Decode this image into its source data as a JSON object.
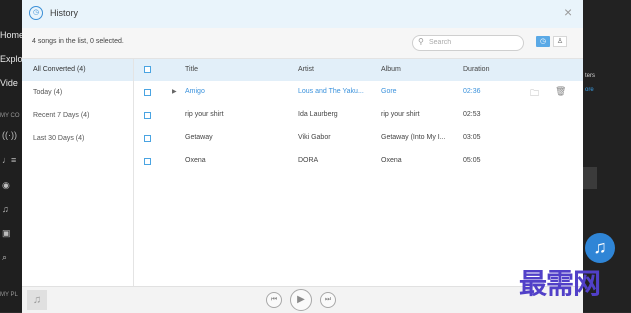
{
  "left_nav": {
    "items": [
      "Home",
      "Explo",
      "Vide"
    ],
    "section_1": "MY CO",
    "section_2": "MY PL"
  },
  "right_strip": {
    "text_1": "ters",
    "text_2": "ore"
  },
  "dialog": {
    "title": "History",
    "close_icon": "×",
    "count_text": "4 songs in the list, 0 selected.",
    "search_placeholder": "Search"
  },
  "sidebar": {
    "items": [
      {
        "label": "All Converted (4)",
        "active": true
      },
      {
        "label": "Today (4)",
        "active": false
      },
      {
        "label": "Recent 7 Days (4)",
        "active": false
      },
      {
        "label": "Last 30 Days (4)",
        "active": false
      }
    ]
  },
  "table": {
    "columns": [
      "Title",
      "Artist",
      "Album",
      "Duration"
    ],
    "rows": [
      {
        "title": "Amigo",
        "artist": "Lous and The Yaku...",
        "album": "Gore",
        "duration": "02:36",
        "highlight": true
      },
      {
        "title": "rip your shirt",
        "artist": "Ida Laurberg",
        "album": "rip your shirt",
        "duration": "02:53",
        "highlight": false
      },
      {
        "title": "Getaway",
        "artist": "Viki Gabor",
        "album": "Getaway (Into My I...",
        "duration": "03:05",
        "highlight": false
      },
      {
        "title": "Oxena",
        "artist": "DORA",
        "album": "Oxena",
        "duration": "05:05",
        "highlight": false
      }
    ]
  },
  "watermark": "最需网",
  "colors": {
    "accent": "#3b92dc",
    "header_bg": "#e2eff9",
    "title_bg": "#e9f4fb"
  }
}
